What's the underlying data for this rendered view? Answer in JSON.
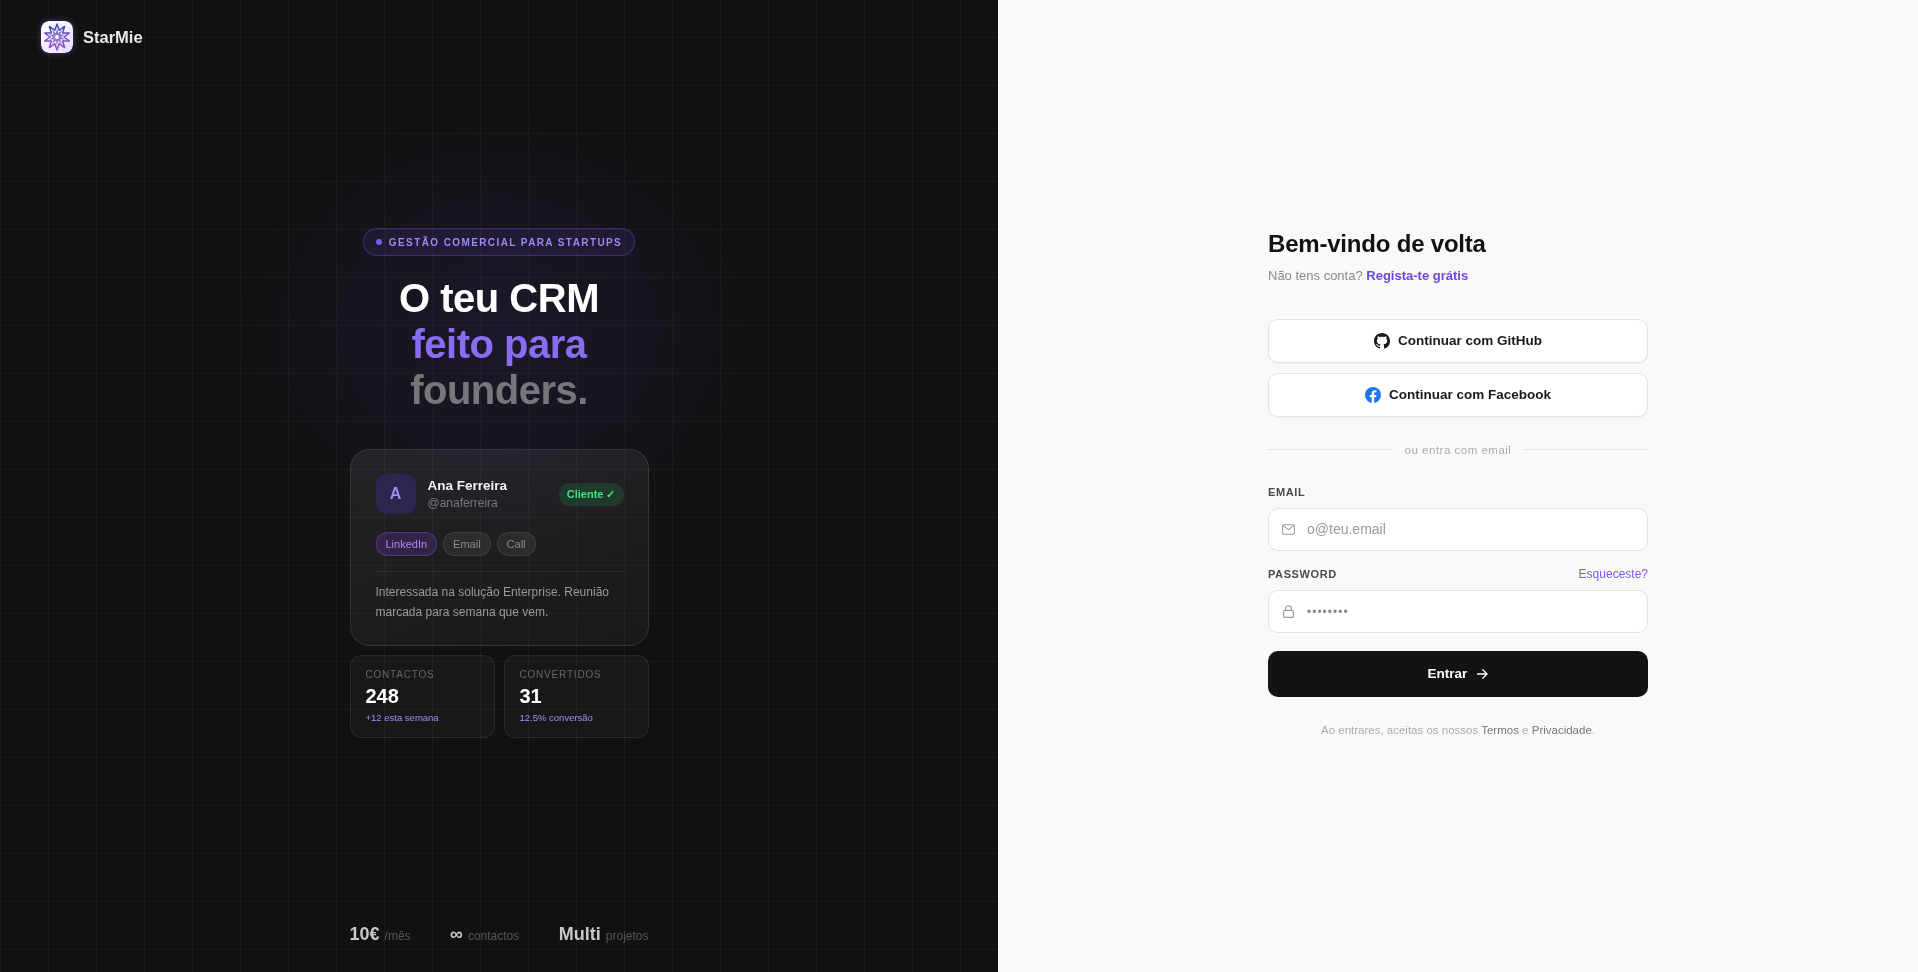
{
  "brand": {
    "name": "StarMie"
  },
  "hero": {
    "eyebrow": "GESTÃO COMERCIAL PARA STARTUPS",
    "headline": [
      {
        "text": "O teu CRM",
        "kind": "primary"
      },
      {
        "text": "feito para",
        "kind": "accent"
      },
      {
        "text": "founders.",
        "kind": "muted"
      }
    ]
  },
  "contact_card": {
    "avatar_initial": "A",
    "name": "Ana Ferreira",
    "handle": "@anaferreira",
    "status": "Cliente ✓",
    "channels": [
      {
        "label": "LinkedIn",
        "selected": true
      },
      {
        "label": "Email",
        "selected": false
      },
      {
        "label": "Call",
        "selected": false
      }
    ],
    "note": "Interessada na solução Enterprise. Reunião marcada para semana que vem."
  },
  "stats": [
    {
      "label": "CONTACTOS",
      "value": "248",
      "change": "+12 esta semana"
    },
    {
      "label": "CONVERTIDOS",
      "value": "31",
      "change": "12.5% conversão"
    }
  ],
  "highlights": [
    {
      "value": "10€",
      "unit": "/mês"
    },
    {
      "value": "∞",
      "unit": "contactos"
    },
    {
      "value": "Multi",
      "unit": "projetos"
    }
  ],
  "login": {
    "title": "Bem-vindo de volta",
    "prompt": "Não tens conta?",
    "signup_link": "Regista-te grátis",
    "social_buttons": [
      {
        "kind": "github",
        "label": "Continuar com GitHub"
      },
      {
        "kind": "facebook",
        "label": "Continuar com Facebook"
      }
    ],
    "divider": "ou entra com email",
    "fields": [
      {
        "kind": "email",
        "label": "EMAIL",
        "placeholder": "o@teu.email"
      },
      {
        "kind": "password",
        "label": "PASSWORD",
        "link": "Esqueceste?",
        "placeholder": "••••••••"
      }
    ],
    "submit": "Entrar",
    "legal": [
      {
        "kind": "text",
        "text": "Ao entrares, aceitas os nossos "
      },
      {
        "kind": "link",
        "text": "Termos"
      },
      {
        "kind": "text",
        "text": " e "
      },
      {
        "kind": "link",
        "text": "Privacidade"
      },
      {
        "kind": "text",
        "text": "."
      }
    ]
  }
}
